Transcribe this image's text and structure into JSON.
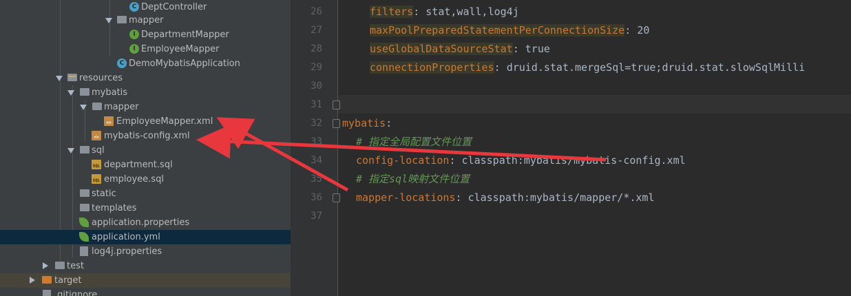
{
  "tree": {
    "items": [
      {
        "label": "DeptController",
        "icon": "class-c-icon"
      },
      {
        "label": "mapper",
        "icon": "folder-icon"
      },
      {
        "label": "DepartmentMapper",
        "icon": "interface-i-icon"
      },
      {
        "label": "EmployeeMapper",
        "icon": "interface-i-icon"
      },
      {
        "label": "DemoMybatisApplication",
        "icon": "class-c-icon"
      },
      {
        "label": "resources",
        "icon": "resources-folder-icon"
      },
      {
        "label": "mybatis",
        "icon": "folder-icon"
      },
      {
        "label": "mapper",
        "icon": "folder-icon"
      },
      {
        "label": "EmployeeMapper.xml",
        "icon": "xml-file-icon"
      },
      {
        "label": "mybatis-config.xml",
        "icon": "xml-file-icon"
      },
      {
        "label": "sql",
        "icon": "folder-icon"
      },
      {
        "label": "department.sql",
        "icon": "sql-file-icon"
      },
      {
        "label": "employee.sql",
        "icon": "sql-file-icon"
      },
      {
        "label": "static",
        "icon": "folder-icon"
      },
      {
        "label": "templates",
        "icon": "folder-icon"
      },
      {
        "label": "application.properties",
        "icon": "spring-leaf-icon"
      },
      {
        "label": "application.yml",
        "icon": "spring-leaf-icon"
      },
      {
        "label": "log4j.properties",
        "icon": "properties-file-icon"
      },
      {
        "label": "test",
        "icon": "folder-icon"
      },
      {
        "label": "target",
        "icon": "target-folder-icon"
      },
      {
        "label": ".gitignore",
        "icon": "file-icon"
      }
    ],
    "icon_text": {
      "c": "C",
      "i": "I",
      "xml": "<>",
      "sql": "SQL"
    }
  },
  "editor": {
    "line_numbers": [
      "26",
      "27",
      "28",
      "29",
      "30",
      "31",
      "32",
      "33",
      "34",
      "35",
      "36",
      "37"
    ],
    "lines": [
      {
        "key": "filters",
        "sep": ": ",
        "val": "stat,wall,log4j"
      },
      {
        "key": "maxPoolPreparedStatementPerConnectionSize",
        "sep": ": ",
        "val": "20"
      },
      {
        "key": "useGlobalDataSourceStat",
        "sep": ": ",
        "val": "true"
      },
      {
        "key": "connectionProperties",
        "sep": ": ",
        "val": "druid.stat.mergeSql=true;druid.stat.slowSqlMilli"
      },
      {
        "key": "mybatis",
        "sep": ":",
        "val": ""
      },
      {
        "comment": "# 指定全局配置文件位置"
      },
      {
        "key": "config-location",
        "sep": ": ",
        "val": "classpath:mybatis/mybatis-config.xml"
      },
      {
        "comment": "# 指定sql映射文件位置"
      },
      {
        "key": "mapper-locations",
        "sep": ": ",
        "val": "classpath:mybatis/mapper/*.xml"
      }
    ]
  },
  "colors": {
    "annotation_arrow": "#e8383d",
    "keyword": "#cc7832",
    "comment": "#629755"
  }
}
